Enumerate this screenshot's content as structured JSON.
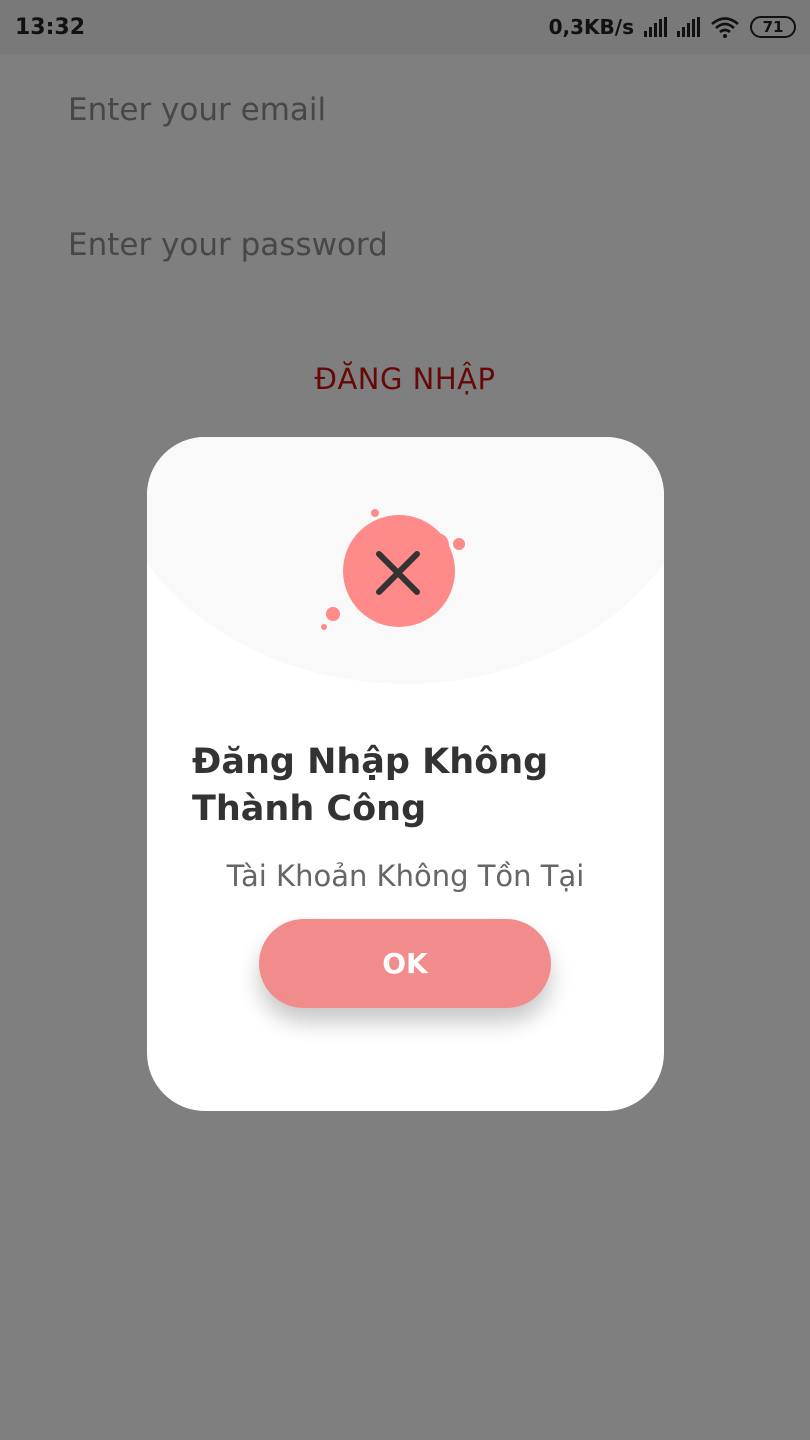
{
  "status_bar": {
    "time": "13:32",
    "net_speed": "0,3KB/s",
    "battery": "71",
    "icons": [
      "signal-icon",
      "signal-icon",
      "wifi-icon",
      "battery-icon"
    ]
  },
  "login": {
    "email_placeholder": "Enter your email",
    "password_placeholder": "Enter your password",
    "login_button": "ĐĂNG NHẬP",
    "login_button_color": "#cc1111"
  },
  "dialog": {
    "icon": "error-x-icon",
    "icon_color": "#ff8a8a",
    "title": "Đăng Nhập Không Thành Công",
    "message": "Tài Khoản Không Tồn Tại",
    "ok_label": "OK",
    "ok_color": "#f28c8c"
  }
}
